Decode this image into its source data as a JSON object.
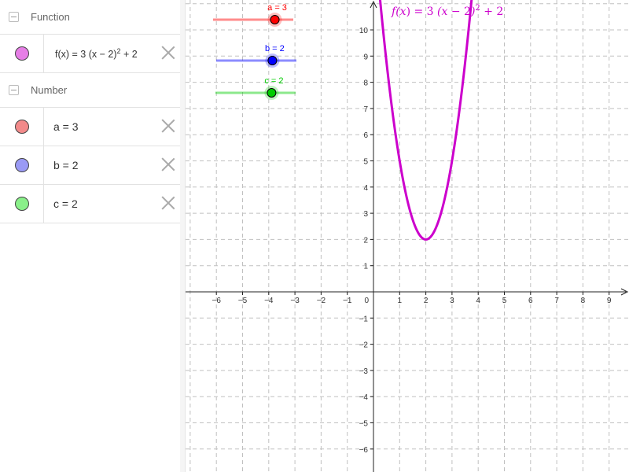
{
  "algebra": {
    "categories": {
      "function": {
        "label": "Function"
      },
      "number": {
        "label": "Number"
      }
    },
    "function_item": {
      "name": "f",
      "prefix": "f(x) = 3 (x − 2)",
      "exponent": "2",
      "suffix": " + 2",
      "color": "#cc00cc",
      "marble_color": "#e67ee6"
    },
    "numbers": [
      {
        "label": "a = 3",
        "color": "#ff0000",
        "marble_color": "#f28a8a"
      },
      {
        "label": "b = 2",
        "color": "#0000ff",
        "marble_color": "#9a9af5"
      },
      {
        "label": "c = 2",
        "color": "#00cc00",
        "marble_color": "#8af08a"
      }
    ]
  },
  "graphics": {
    "x_range": [
      -7,
      10.7
    ],
    "y_range": [
      -6.7,
      11.2
    ],
    "x_ticks": [
      -6,
      -5,
      -4,
      -3,
      -2,
      -1,
      0,
      1,
      2,
      3,
      4,
      5,
      6,
      7,
      8,
      9
    ],
    "y_ticks": [
      -6,
      -5,
      -4,
      -3,
      -2,
      -1,
      1,
      2,
      3,
      4,
      5,
      6,
      7,
      8,
      9,
      10
    ],
    "origin_label": "0",
    "function_label": {
      "f": "f",
      "x": "x",
      "coef": "3",
      "h": "2",
      "k": "2",
      "exponent": "2",
      "color": "#cc00cc"
    },
    "function": {
      "a": 3,
      "h": 2,
      "k": 2,
      "color": "#cc00cc"
    },
    "sliders": [
      {
        "name": "a",
        "label": "a = 3",
        "color": "#ff0000",
        "value": 3,
        "fraction": 0.77
      },
      {
        "name": "b",
        "label": "b = 2",
        "color": "#0000ff",
        "value": 2,
        "fraction": 0.7
      },
      {
        "name": "c",
        "label": "c = 2",
        "color": "#00cc00",
        "value": 2,
        "fraction": 0.7
      }
    ]
  }
}
